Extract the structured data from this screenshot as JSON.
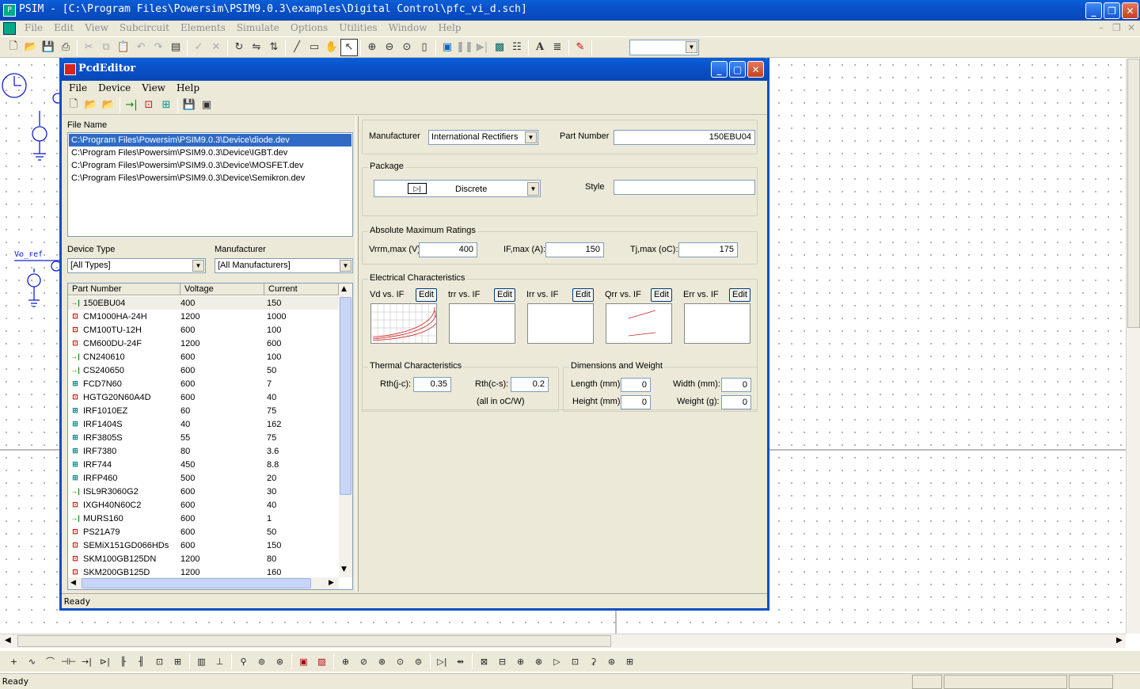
{
  "app": {
    "title": "PSIM - [C:\\Program Files\\Powersim\\PSIM9.0.3\\examples\\Digital Control\\pfc_vi_d.sch]",
    "menus": [
      "File",
      "Edit",
      "View",
      "Subcircuit",
      "Elements",
      "Simulate",
      "Options",
      "Utilities",
      "Window",
      "Help"
    ],
    "status": "Ready",
    "schematic_labels": {
      "vo_ref": "Vo_ref"
    }
  },
  "editor": {
    "title": "PcdEditor",
    "menus": [
      "File",
      "Device",
      "View",
      "Help"
    ],
    "status": "Ready",
    "file_list": {
      "label": "File Name",
      "files": [
        "C:\\Program Files\\Powersim\\PSIM9.0.3\\Device\\diode.dev",
        "C:\\Program Files\\Powersim\\PSIM9.0.3\\Device\\IGBT.dev",
        "C:\\Program Files\\Powersim\\PSIM9.0.3\\Device\\MOSFET.dev",
        "C:\\Program Files\\Powersim\\PSIM9.0.3\\Device\\Semikron.dev"
      ]
    },
    "filters": {
      "device_type_label": "Device Type",
      "device_type_value": "[All Types]",
      "manufacturer_label": "Manufacturer",
      "manufacturer_value": "[All Manufacturers]"
    },
    "device_table": {
      "headers": [
        "Part Number",
        "Voltage",
        "Current"
      ],
      "rows": [
        {
          "icon": "diode-icon",
          "part": "150EBU04",
          "voltage": "400",
          "current": "150"
        },
        {
          "icon": "igbt-icon",
          "part": "CM1000HA-24H",
          "voltage": "1200",
          "current": "1000"
        },
        {
          "icon": "igbt-icon",
          "part": "CM100TU-12H",
          "voltage": "600",
          "current": "100"
        },
        {
          "icon": "igbt-icon",
          "part": "CM600DU-24F",
          "voltage": "1200",
          "current": "600"
        },
        {
          "icon": "diode-icon",
          "part": "CN240610",
          "voltage": "600",
          "current": "100"
        },
        {
          "icon": "diode-icon",
          "part": "CS240650",
          "voltage": "600",
          "current": "50"
        },
        {
          "icon": "mosfet-icon",
          "part": "FCD7N60",
          "voltage": "600",
          "current": "7"
        },
        {
          "icon": "igbt-icon",
          "part": "HGTG20N60A4D",
          "voltage": "600",
          "current": "40"
        },
        {
          "icon": "mosfet-icon",
          "part": "IRF1010EZ",
          "voltage": "60",
          "current": "75"
        },
        {
          "icon": "mosfet-icon",
          "part": "IRF1404S",
          "voltage": "40",
          "current": "162"
        },
        {
          "icon": "mosfet-icon",
          "part": "IRF3805S",
          "voltage": "55",
          "current": "75"
        },
        {
          "icon": "mosfet-icon",
          "part": "IRF7380",
          "voltage": "80",
          "current": "3.6"
        },
        {
          "icon": "mosfet-icon",
          "part": "IRF744",
          "voltage": "450",
          "current": "8.8"
        },
        {
          "icon": "mosfet-icon",
          "part": "IRFP460",
          "voltage": "500",
          "current": "20"
        },
        {
          "icon": "diode-icon",
          "part": "ISL9R3060G2",
          "voltage": "600",
          "current": "30"
        },
        {
          "icon": "igbt-icon",
          "part": "IXGH40N60C2",
          "voltage": "600",
          "current": "40"
        },
        {
          "icon": "diode-icon",
          "part": "MURS160",
          "voltage": "600",
          "current": "1"
        },
        {
          "icon": "igbt-icon",
          "part": "PS21A79",
          "voltage": "600",
          "current": "50"
        },
        {
          "icon": "igbt-icon",
          "part": "SEMiX151GD066HDs",
          "voltage": "600",
          "current": "150"
        },
        {
          "icon": "igbt-icon",
          "part": "SKM100GB125DN",
          "voltage": "1200",
          "current": "80"
        },
        {
          "icon": "igbt-icon",
          "part": "SKM200GB125D",
          "voltage": "1200",
          "current": "160"
        }
      ]
    },
    "details": {
      "manufacturer_label": "Manufacturer",
      "manufacturer_value": "International Rectifiers",
      "part_number_label": "Part Number",
      "part_number_value": "150EBU04",
      "package_title": "Package",
      "package_value": "Discrete",
      "style_label": "Style",
      "style_value": "",
      "ratings_title": "Absolute Maximum Ratings",
      "vrrm_label": "Vrrm,max (V):",
      "vrrm_value": "400",
      "ifmax_label": "IF,max (A):",
      "ifmax_value": "150",
      "tjmax_label": "Tj,max (oC):",
      "tjmax_value": "175",
      "electrical_title": "Electrical Characteristics",
      "graphs": [
        {
          "label": "Vd vs. IF",
          "edit": "Edit"
        },
        {
          "label": "trr vs. IF",
          "edit": "Edit"
        },
        {
          "label": "Irr vs. IF",
          "edit": "Edit"
        },
        {
          "label": "Qrr vs. IF",
          "edit": "Edit"
        },
        {
          "label": "Err vs. IF",
          "edit": "Edit"
        }
      ],
      "thermal_title": "Thermal Characteristics",
      "rthjc_label": "Rth(j-c):",
      "rthjc_value": "0.35",
      "rthcs_label": "Rth(c-s):",
      "rthcs_value": "0.2",
      "thermal_unit": "(all in oC/W)",
      "dims_title": "Dimensions and Weight",
      "length_label": "Length (mm):",
      "length_value": "0",
      "width_label": "Width (mm):",
      "width_value": "0",
      "height_label": "Height (mm):",
      "height_value": "0",
      "weight_label": "Weight (g):",
      "weight_value": "0"
    }
  },
  "colors": {
    "title_bar": "#0a50c8",
    "window_bg": "#ece9d8",
    "selection": "#316ac5"
  }
}
